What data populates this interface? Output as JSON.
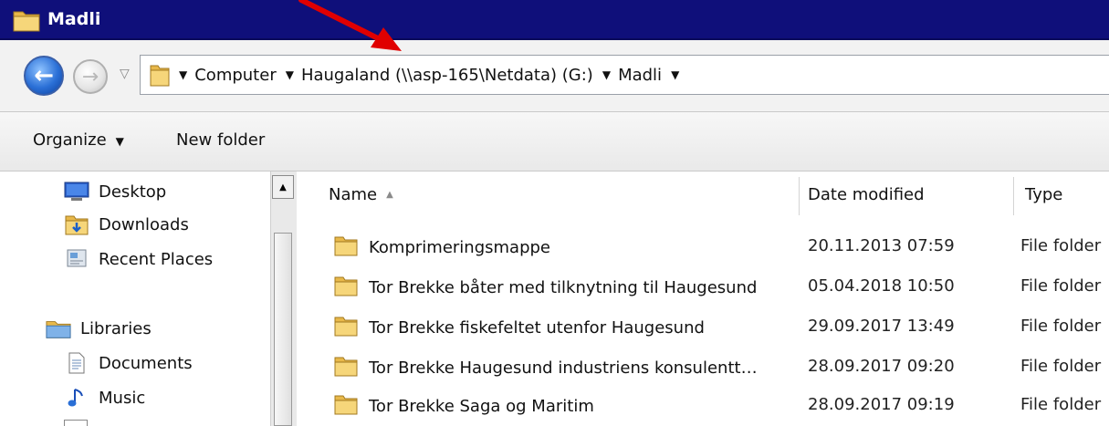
{
  "window": {
    "title": "Madli"
  },
  "addressbar": {
    "crumbs": [
      "Computer",
      "Haugaland (\\\\asp-165\\Netdata) (G:)",
      "Madli"
    ]
  },
  "toolbar": {
    "organize_label": "Organize",
    "new_folder_label": "New folder"
  },
  "navigation": {
    "favorites": [
      {
        "label": "Desktop",
        "icon": "desktop-icon"
      },
      {
        "label": "Downloads",
        "icon": "downloads-folder-icon"
      },
      {
        "label": "Recent Places",
        "icon": "recent-places-icon"
      }
    ],
    "libraries": {
      "label": "Libraries",
      "items": [
        {
          "label": "Documents",
          "icon": "documents-icon"
        },
        {
          "label": "Music",
          "icon": "music-icon"
        }
      ]
    }
  },
  "file_list": {
    "columns": [
      "Name",
      "Date modified",
      "Type"
    ],
    "sorted_by": "Name",
    "rows": [
      {
        "name": "Komprimeringsmappe",
        "date": "20.11.2013 07:59",
        "type": "File folder"
      },
      {
        "name": "Tor Brekke båter med tilknytning til Haugesund",
        "date": "05.04.2018 10:50",
        "type": "File folder"
      },
      {
        "name": "Tor Brekke fiskefeltet utenfor Haugesund",
        "date": "29.09.2017 13:49",
        "type": "File folder"
      },
      {
        "name": "Tor Brekke Haugesund industriens konsulentt…",
        "date": "28.09.2017 09:20",
        "type": "File folder"
      },
      {
        "name": "Tor Brekke Saga og Maritim",
        "date": "28.09.2017 09:19",
        "type": "File folder"
      }
    ]
  },
  "colors": {
    "titlebar": "#0f0f7a",
    "annotation_arrow": "#e00000",
    "folder": "#e8b84a"
  }
}
